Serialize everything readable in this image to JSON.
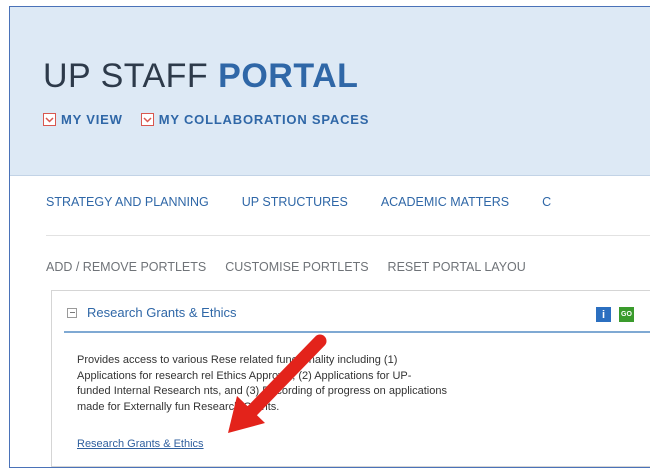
{
  "header": {
    "title_light": "UP STAFF",
    "title_bold": "PORTAL",
    "subnav": [
      {
        "label": "MY VIEW",
        "icon": "chevron-down-icon"
      },
      {
        "label": "MY COLLABORATION SPACES",
        "icon": "chevron-down-icon"
      }
    ]
  },
  "nav": {
    "main": [
      "STRATEGY AND PLANNING",
      "UP STRUCTURES",
      "ACADEMIC MATTERS",
      "C"
    ],
    "portlet_actions": [
      "ADD / REMOVE PORTLETS",
      "CUSTOMISE PORTLETS",
      "RESET PORTAL LAYOU"
    ]
  },
  "portlet": {
    "title": "Research Grants & Ethics",
    "info_label": "i",
    "go_label": "GO",
    "description": [
      "Provides access to various Rese    related functionality including (1)",
      "Applications for research rel     Ethics Approval; (2) Applications for UP-",
      "funded Internal Research     nts, and (3) Recording of progress on applications",
      "made for Externally fun     Research Grants."
    ],
    "link": "Research Grants & Ethics"
  },
  "colors": {
    "header_bg": "#dde9f5",
    "brand_blue": "#2f67a7",
    "annotation_arrow": "#e3231b",
    "go_green": "#3a9b2c"
  }
}
